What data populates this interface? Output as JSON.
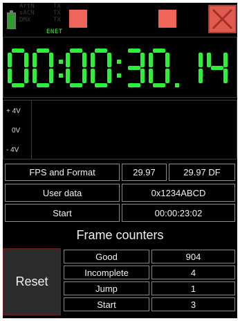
{
  "status": {
    "protocols": [
      "ArtN",
      "sACN",
      "DMX"
    ],
    "tx_label": "TX",
    "network": "ENET",
    "colors": {
      "indicator_red": "#f0655a",
      "battery_green": "#2e9e2e",
      "segment_green": "#2df03a"
    }
  },
  "timecode": "00:00:30.14",
  "meter": {
    "labels": [
      "+ 4V",
      "0V",
      "- 4V"
    ]
  },
  "info": {
    "fps_label": "FPS and Format",
    "fps_value": "29.97",
    "fps_format": "29.97  DF",
    "user_data_label": "User data",
    "user_data_value": "0x1234ABCD",
    "start_label": "Start",
    "start_value": "00:00:23:02"
  },
  "frame_counters": {
    "title": "Frame counters",
    "reset_label": "Reset",
    "rows": [
      {
        "label": "Good",
        "value": "904"
      },
      {
        "label": "Incomplete",
        "value": "4"
      },
      {
        "label": "Jump",
        "value": "1"
      },
      {
        "label": "Start",
        "value": "3"
      }
    ]
  },
  "icons": {
    "close": "close-x-icon",
    "battery": "battery-icon"
  }
}
